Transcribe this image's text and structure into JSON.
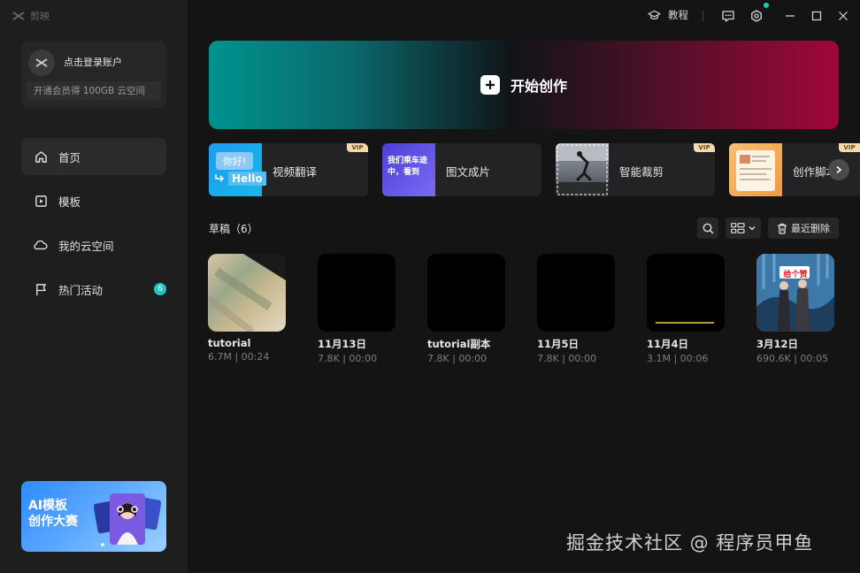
{
  "app": {
    "name": "剪映"
  },
  "sidebar": {
    "login_label": "点击登录账户",
    "vip_offer": "开通会员得 100GB 云空间",
    "items": [
      {
        "label": "首页",
        "icon": "home-icon",
        "active": true
      },
      {
        "label": "模板",
        "icon": "template-icon",
        "active": false
      },
      {
        "label": "我的云空间",
        "icon": "cloud-icon",
        "active": false
      },
      {
        "label": "热门活动",
        "icon": "flag-icon",
        "active": false,
        "badge": "6"
      }
    ],
    "promo": {
      "title": "AI模板\n创作大赛"
    }
  },
  "titlebar": {
    "tutorial_label": "教程",
    "accent": "#1ec8c0"
  },
  "hero": {
    "label": "开始创作"
  },
  "features": [
    {
      "label": "视频翻译",
      "thumb_text_top": "你好!",
      "thumb_text_bottom": "Hello",
      "vip": "VIP"
    },
    {
      "label": "图文成片",
      "thumb_text": "我们乘车途中，看到",
      "vip": ""
    },
    {
      "label": "智能裁剪",
      "vip": "VIP"
    },
    {
      "label": "创作脚本",
      "vip": "VIP"
    }
  ],
  "drafts": {
    "title": "草稿（6）",
    "recent_delete_label": "最近删除",
    "items": [
      {
        "name": "tutorial",
        "meta": "6.7M | 00:24"
      },
      {
        "name": "11月13日",
        "meta": "7.8K | 00:00"
      },
      {
        "name": "tutorial副本",
        "meta": "7.8K | 00:00"
      },
      {
        "name": "11月5日",
        "meta": "7.8K | 00:00"
      },
      {
        "name": "11月4日",
        "meta": "3.1M | 00:06"
      },
      {
        "name": "3月12日",
        "meta": "690.6K | 00:05",
        "thumb_sign": "给个赞"
      }
    ]
  },
  "watermark": "掘金技术社区 @ 程序员甲鱼"
}
